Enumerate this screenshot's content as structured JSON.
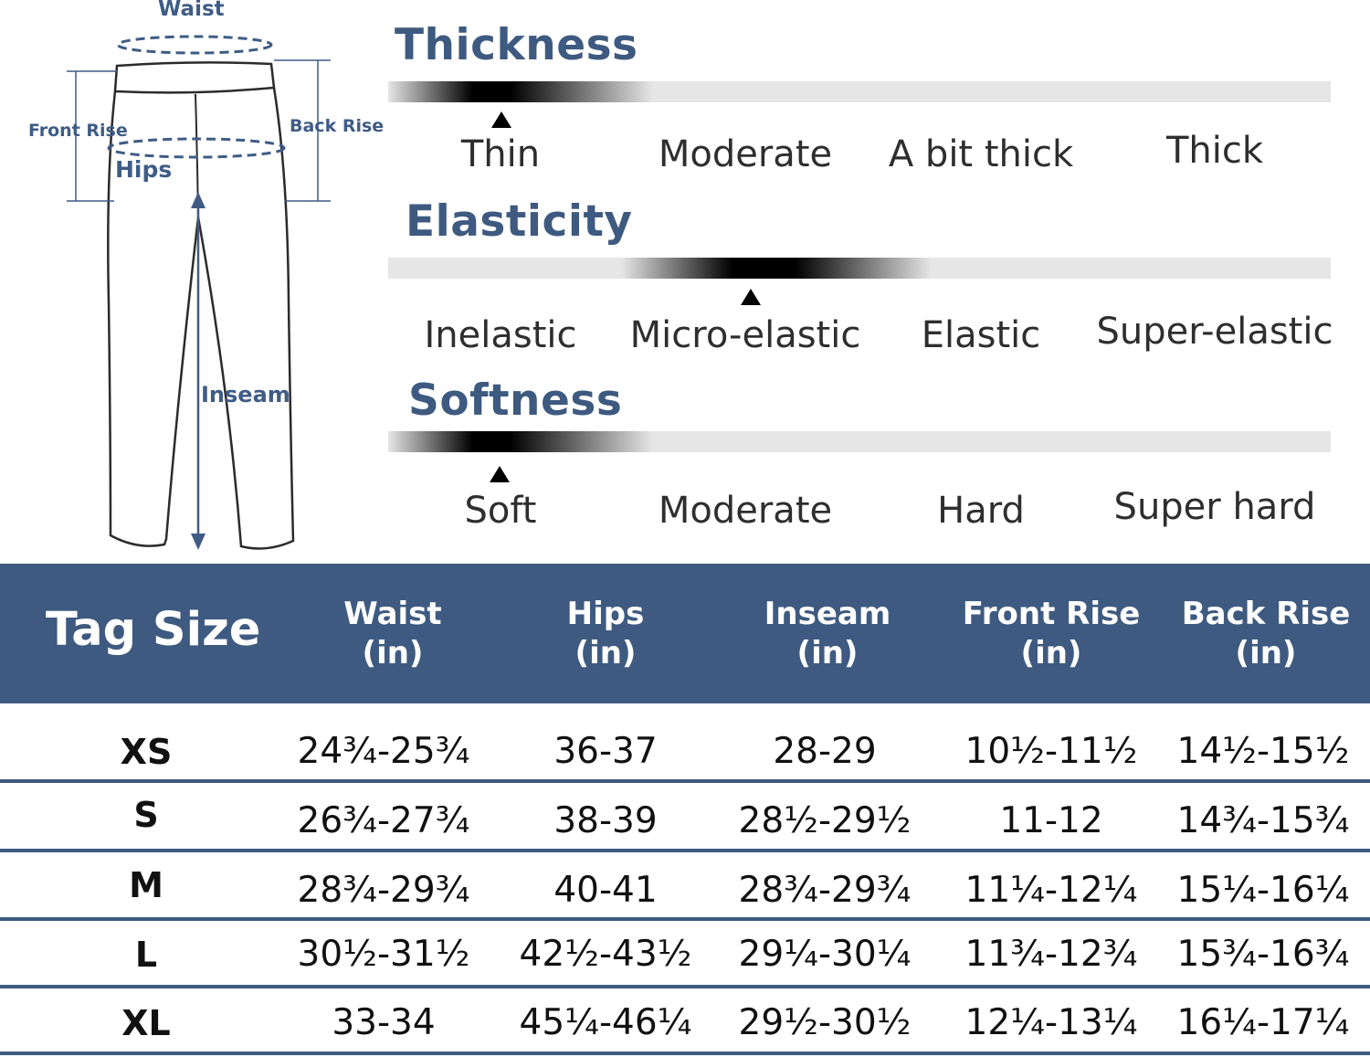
{
  "diagram": {
    "labels": {
      "waist": "Waist",
      "front_rise": "Front Rise",
      "back_rise": "Back Rise",
      "hips": "Hips",
      "inseam": "Inseam"
    }
  },
  "scales": [
    {
      "title": "Thickness",
      "options": [
        "Thin",
        "Moderate",
        "A bit thick",
        "Thick"
      ],
      "selected_index": 0
    },
    {
      "title": "Elasticity",
      "options": [
        "Inelastic",
        "Micro-elastic",
        "Elastic",
        "Super-elastic"
      ],
      "selected_index": 1
    },
    {
      "title": "Softness",
      "options": [
        "Soft",
        "Moderate",
        "Hard",
        "Super hard"
      ],
      "selected_index": 0
    }
  ],
  "size_table": {
    "header": {
      "tag": "Tag Size",
      "columns": [
        {
          "name": "Waist",
          "unit": "(in)"
        },
        {
          "name": "Hips",
          "unit": "(in)"
        },
        {
          "name": "Inseam",
          "unit": "(in)"
        },
        {
          "name": "Front Rise",
          "unit": "(in)"
        },
        {
          "name": "Back Rise",
          "unit": "(in)"
        }
      ]
    },
    "rows": [
      {
        "tag": "XS",
        "values": [
          "24¾-25¾",
          "36-37",
          "28-29",
          "10½-11½",
          "14½-15½"
        ]
      },
      {
        "tag": "S",
        "values": [
          "26¾-27¾",
          "38-39",
          "28½-29½",
          "11-12",
          "14¾-15¾"
        ]
      },
      {
        "tag": "M",
        "values": [
          "28¾-29¾",
          "40-41",
          "28¾-29¾",
          "11¼-12¼",
          "15¼-16¼"
        ]
      },
      {
        "tag": "L",
        "values": [
          "30½-31½",
          "42½-43½",
          "29¼-30¼",
          "11¾-12¾",
          "15¾-16¾"
        ]
      },
      {
        "tag": "XL",
        "values": [
          "33-34",
          "45¼-46¼",
          "29½-30½",
          "12¼-13¼",
          "16¼-17¼"
        ]
      }
    ]
  },
  "colors": {
    "accent": "#3e5a80",
    "bar_track": "#e6e6e6",
    "text": "#111111"
  }
}
